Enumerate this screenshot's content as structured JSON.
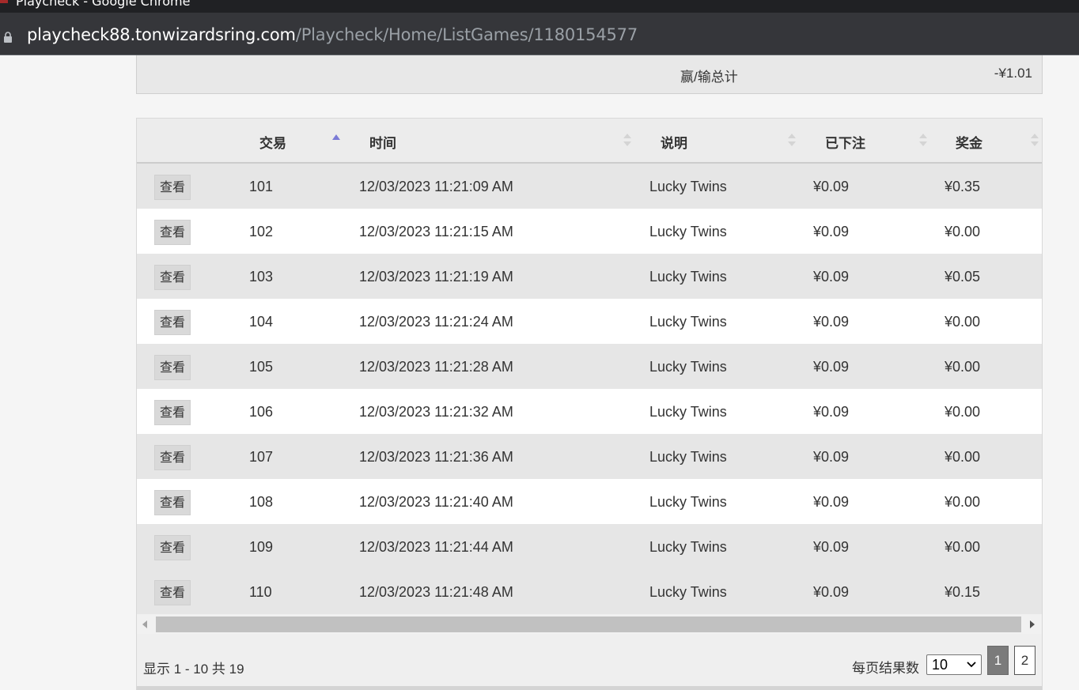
{
  "window": {
    "title": "Playcheck - Google Chrome",
    "url_host": "playcheck88.tonwizardsring.com",
    "url_path": "/Playcheck/Home/ListGames/1180154577"
  },
  "summary": {
    "label": "赢/输总计",
    "value": "-¥1.01"
  },
  "table": {
    "columns": [
      {
        "label": "交易",
        "sort": "ascending"
      },
      {
        "label": "时间",
        "sort": "none"
      },
      {
        "label": "说明",
        "sort": "none"
      },
      {
        "label": "已下注",
        "sort": "none"
      },
      {
        "label": "奖金",
        "sort": "none"
      }
    ],
    "view_label": "查看",
    "rows": [
      {
        "txn": "101",
        "time": "12/03/2023 11:21:09 AM",
        "desc": "Lucky Twins",
        "bet": "¥0.09",
        "win": "¥0.35"
      },
      {
        "txn": "102",
        "time": "12/03/2023 11:21:15 AM",
        "desc": "Lucky Twins",
        "bet": "¥0.09",
        "win": "¥0.00"
      },
      {
        "txn": "103",
        "time": "12/03/2023 11:21:19 AM",
        "desc": "Lucky Twins",
        "bet": "¥0.09",
        "win": "¥0.05"
      },
      {
        "txn": "104",
        "time": "12/03/2023 11:21:24 AM",
        "desc": "Lucky Twins",
        "bet": "¥0.09",
        "win": "¥0.00"
      },
      {
        "txn": "105",
        "time": "12/03/2023 11:21:28 AM",
        "desc": "Lucky Twins",
        "bet": "¥0.09",
        "win": "¥0.00"
      },
      {
        "txn": "106",
        "time": "12/03/2023 11:21:32 AM",
        "desc": "Lucky Twins",
        "bet": "¥0.09",
        "win": "¥0.00"
      },
      {
        "txn": "107",
        "time": "12/03/2023 11:21:36 AM",
        "desc": "Lucky Twins",
        "bet": "¥0.09",
        "win": "¥0.00"
      },
      {
        "txn": "108",
        "time": "12/03/2023 11:21:40 AM",
        "desc": "Lucky Twins",
        "bet": "¥0.09",
        "win": "¥0.00"
      },
      {
        "txn": "109",
        "time": "12/03/2023 11:21:44 AM",
        "desc": "Lucky Twins",
        "bet": "¥0.09",
        "win": "¥0.00"
      },
      {
        "txn": "110",
        "time": "12/03/2023 11:21:48 AM",
        "desc": "Lucky Twins",
        "bet": "¥0.09",
        "win": "¥0.15"
      }
    ]
  },
  "footer": {
    "info": "显示 1 - 10 共 19",
    "per_page_label": "每页结果数",
    "per_page_value": "10",
    "pages": [
      "1",
      "2"
    ],
    "current_page": "1"
  },
  "colors": {
    "row_odd": "#e6e6e6",
    "row_even": "#ffffff",
    "sort_active": "#7b7bd6",
    "sort_inactive": "#d4d4d4",
    "page_active": "#7b7b7b"
  }
}
